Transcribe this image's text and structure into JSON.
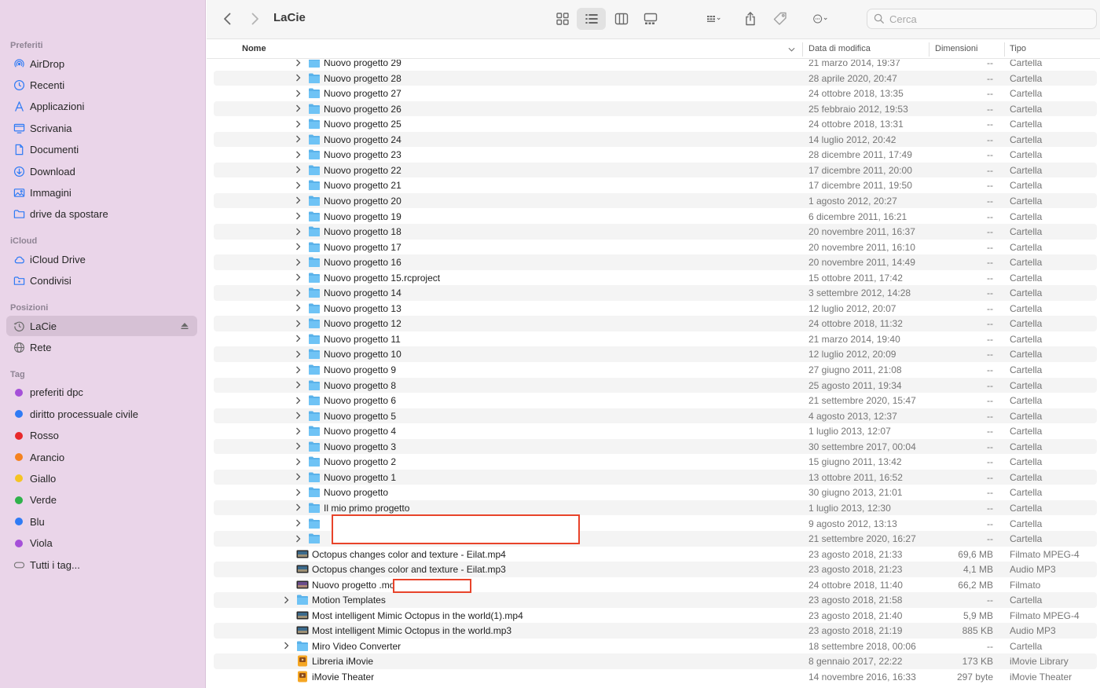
{
  "window": {
    "title": "LaCie"
  },
  "search": {
    "placeholder": "Cerca"
  },
  "sidebar": {
    "sections": [
      {
        "title": "Preferiti",
        "items": [
          {
            "label": "AirDrop",
            "icon": "airdrop-icon"
          },
          {
            "label": "Recenti",
            "icon": "clock-icon"
          },
          {
            "label": "Applicazioni",
            "icon": "applications-icon"
          },
          {
            "label": "Scrivania",
            "icon": "desktop-icon"
          },
          {
            "label": "Documenti",
            "icon": "document-icon"
          },
          {
            "label": "Download",
            "icon": "download-icon"
          },
          {
            "label": "Immagini",
            "icon": "photo-icon"
          },
          {
            "label": "drive da spostare",
            "icon": "folder-icon"
          }
        ]
      },
      {
        "title": "iCloud",
        "items": [
          {
            "label": "iCloud Drive",
            "icon": "cloud-icon"
          },
          {
            "label": "Condivisi",
            "icon": "shared-folder-icon"
          }
        ]
      },
      {
        "title": "Posizioni",
        "items": [
          {
            "label": "LaCie",
            "icon": "time-machine-icon",
            "active": true
          },
          {
            "label": "Rete",
            "icon": "globe-icon"
          }
        ]
      },
      {
        "title": "Tag",
        "items": [
          {
            "label": "preferiti dpc",
            "color": "#a550d8"
          },
          {
            "label": "diritto processuale civile",
            "color": "#2f7bf5"
          },
          {
            "label": "Rosso",
            "color": "#e8282b"
          },
          {
            "label": "Arancio",
            "color": "#f5821f"
          },
          {
            "label": "Giallo",
            "color": "#f5c423"
          },
          {
            "label": "Verde",
            "color": "#2fb24b"
          },
          {
            "label": "Blu",
            "color": "#2f7bf5"
          },
          {
            "label": "Viola",
            "color": "#a550d8"
          },
          {
            "label": "Tutti i tag...",
            "icon": "all-tags-icon"
          }
        ]
      }
    ]
  },
  "columns": {
    "name": "Nome",
    "date": "Data di modifica",
    "size": "Dimensioni",
    "kind": "Tipo"
  },
  "rows": [
    {
      "name": "Nuovo progetto 29",
      "date": "21 marzo 2014, 19:37",
      "size": "--",
      "kind": "Cartella",
      "type": "folder",
      "level": 1
    },
    {
      "name": "Nuovo progetto 28",
      "date": "28 aprile 2020, 20:47",
      "size": "--",
      "kind": "Cartella",
      "type": "folder",
      "level": 1
    },
    {
      "name": "Nuovo progetto 27",
      "date": "24 ottobre 2018, 13:35",
      "size": "--",
      "kind": "Cartella",
      "type": "folder",
      "level": 1
    },
    {
      "name": "Nuovo progetto 26",
      "date": "25 febbraio 2012, 19:53",
      "size": "--",
      "kind": "Cartella",
      "type": "folder",
      "level": 1
    },
    {
      "name": "Nuovo progetto 25",
      "date": "24 ottobre 2018, 13:31",
      "size": "--",
      "kind": "Cartella",
      "type": "folder",
      "level": 1
    },
    {
      "name": "Nuovo progetto 24",
      "date": "14 luglio 2012, 20:42",
      "size": "--",
      "kind": "Cartella",
      "type": "folder",
      "level": 1
    },
    {
      "name": "Nuovo progetto 23",
      "date": "28 dicembre 2011, 17:49",
      "size": "--",
      "kind": "Cartella",
      "type": "folder",
      "level": 1
    },
    {
      "name": "Nuovo progetto 22",
      "date": "17 dicembre 2011, 20:00",
      "size": "--",
      "kind": "Cartella",
      "type": "folder",
      "level": 1
    },
    {
      "name": "Nuovo progetto 21",
      "date": "17 dicembre 2011, 19:50",
      "size": "--",
      "kind": "Cartella",
      "type": "folder",
      "level": 1
    },
    {
      "name": "Nuovo progetto 20",
      "date": "1 agosto 2012, 20:27",
      "size": "--",
      "kind": "Cartella",
      "type": "folder",
      "level": 1
    },
    {
      "name": "Nuovo progetto 19",
      "date": "6 dicembre 2011, 16:21",
      "size": "--",
      "kind": "Cartella",
      "type": "folder",
      "level": 1
    },
    {
      "name": "Nuovo progetto 18",
      "date": "20 novembre 2011, 16:37",
      "size": "--",
      "kind": "Cartella",
      "type": "folder",
      "level": 1
    },
    {
      "name": "Nuovo progetto 17",
      "date": "20 novembre 2011, 16:10",
      "size": "--",
      "kind": "Cartella",
      "type": "folder",
      "level": 1
    },
    {
      "name": "Nuovo progetto 16",
      "date": "20 novembre 2011, 14:49",
      "size": "--",
      "kind": "Cartella",
      "type": "folder",
      "level": 1
    },
    {
      "name": "Nuovo progetto 15.rcproject",
      "date": "15 ottobre 2011, 17:42",
      "size": "--",
      "kind": "Cartella",
      "type": "folder",
      "level": 1
    },
    {
      "name": "Nuovo progetto 14",
      "date": "3 settembre 2012, 14:28",
      "size": "--",
      "kind": "Cartella",
      "type": "folder",
      "level": 1
    },
    {
      "name": "Nuovo progetto 13",
      "date": "12 luglio 2012, 20:07",
      "size": "--",
      "kind": "Cartella",
      "type": "folder",
      "level": 1
    },
    {
      "name": "Nuovo progetto 12",
      "date": "24 ottobre 2018, 11:32",
      "size": "--",
      "kind": "Cartella",
      "type": "folder",
      "level": 1
    },
    {
      "name": "Nuovo progetto 11",
      "date": "21 marzo 2014, 19:40",
      "size": "--",
      "kind": "Cartella",
      "type": "folder",
      "level": 1
    },
    {
      "name": "Nuovo progetto 10",
      "date": "12 luglio 2012, 20:09",
      "size": "--",
      "kind": "Cartella",
      "type": "folder",
      "level": 1
    },
    {
      "name": "Nuovo progetto 9",
      "date": "27 giugno 2011, 21:08",
      "size": "--",
      "kind": "Cartella",
      "type": "folder",
      "level": 1
    },
    {
      "name": "Nuovo progetto 8",
      "date": "25 agosto 2011, 19:34",
      "size": "--",
      "kind": "Cartella",
      "type": "folder",
      "level": 1
    },
    {
      "name": "Nuovo progetto 6",
      "date": "21 settembre 2020, 15:47",
      "size": "--",
      "kind": "Cartella",
      "type": "folder",
      "level": 1
    },
    {
      "name": "Nuovo progetto 5",
      "date": "4 agosto 2013, 12:37",
      "size": "--",
      "kind": "Cartella",
      "type": "folder",
      "level": 1
    },
    {
      "name": "Nuovo progetto 4",
      "date": "1 luglio 2013, 12:07",
      "size": "--",
      "kind": "Cartella",
      "type": "folder",
      "level": 1
    },
    {
      "name": "Nuovo progetto 3",
      "date": "30 settembre 2017, 00:04",
      "size": "--",
      "kind": "Cartella",
      "type": "folder",
      "level": 1
    },
    {
      "name": "Nuovo progetto 2",
      "date": "15 giugno 2011, 13:42",
      "size": "--",
      "kind": "Cartella",
      "type": "folder",
      "level": 1
    },
    {
      "name": "Nuovo progetto 1",
      "date": "13 ottobre 2011, 16:52",
      "size": "--",
      "kind": "Cartella",
      "type": "folder",
      "level": 1
    },
    {
      "name": "Nuovo progetto",
      "date": "30 giugno 2013, 21:01",
      "size": "--",
      "kind": "Cartella",
      "type": "folder",
      "level": 1
    },
    {
      "name": "Il mio primo progetto",
      "date": "1 luglio 2013, 12:30",
      "size": "--",
      "kind": "Cartella",
      "type": "folder",
      "level": 1
    },
    {
      "name": "",
      "date": "9 agosto 2012, 13:13",
      "size": "--",
      "kind": "Cartella",
      "type": "folder",
      "level": 1
    },
    {
      "name": "",
      "date": "21 settembre 2020, 16:27",
      "size": "--",
      "kind": "Cartella",
      "type": "folder",
      "level": 1
    },
    {
      "name": "Octopus changes color and texture - Eilat.mp4",
      "date": "23 agosto 2018, 21:33",
      "size": "69,6 MB",
      "kind": "Filmato MPEG-4",
      "type": "video",
      "level": 0
    },
    {
      "name": "Octopus changes color and texture - Eilat.mp3",
      "date": "23 agosto 2018, 21:23",
      "size": "4,1 MB",
      "kind": "Audio MP3",
      "type": "video",
      "level": 0
    },
    {
      "name": "Nuovo progetto                      .mov",
      "date": "24 ottobre 2018, 11:40",
      "size": "66,2 MB",
      "kind": "Filmato",
      "type": "video-purple",
      "level": 0
    },
    {
      "name": "Motion Templates",
      "date": "23 agosto 2018, 21:58",
      "size": "--",
      "kind": "Cartella",
      "type": "folder",
      "level": 0
    },
    {
      "name": "Most intelligent Mimic Octopus in the world(1).mp4",
      "date": "23 agosto 2018, 21:40",
      "size": "5,9 MB",
      "kind": "Filmato MPEG-4",
      "type": "video",
      "level": 0
    },
    {
      "name": "Most intelligent Mimic Octopus in the world.mp3",
      "date": "23 agosto 2018, 21:19",
      "size": "885 KB",
      "kind": "Audio MP3",
      "type": "video",
      "level": 0
    },
    {
      "name": "Miro Video Converter",
      "date": "18 settembre 2018, 00:06",
      "size": "--",
      "kind": "Cartella",
      "type": "folder",
      "level": 0
    },
    {
      "name": "Libreria iMovie",
      "date": "8 gennaio 2017, 22:22",
      "size": "173 KB",
      "kind": "iMovie Library",
      "type": "imovie",
      "level": 0
    },
    {
      "name": "iMovie Theater",
      "date": "14 novembre 2016, 16:33",
      "size": "297 byte",
      "kind": "iMovie Theater",
      "type": "imovie",
      "level": 0
    }
  ]
}
